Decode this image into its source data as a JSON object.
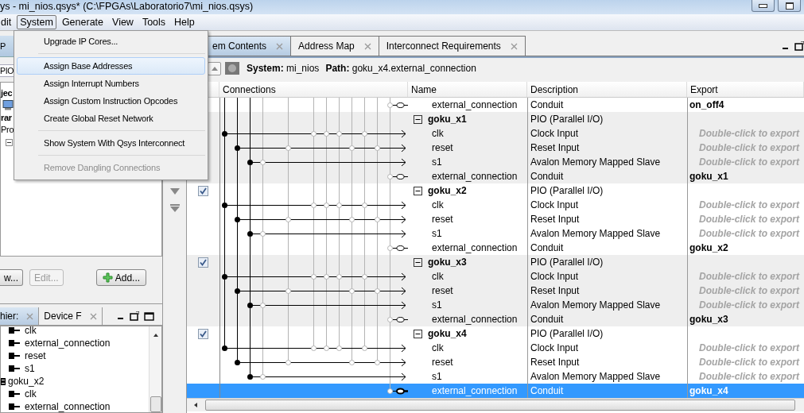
{
  "window": {
    "title": "ys - mi_nios.qsys* (C:\\FPGAs\\Laboratorio7\\mi_nios.qsys)"
  },
  "menu_bar": [
    {
      "label": "dit",
      "selected": false
    },
    {
      "label": "System",
      "selected": true
    },
    {
      "label": "Generate",
      "selected": false
    },
    {
      "label": "View",
      "selected": false
    },
    {
      "label": "Tools",
      "selected": false
    },
    {
      "label": "Help",
      "selected": false
    }
  ],
  "system_menu": [
    {
      "kind": "item",
      "label": "Upgrade IP Cores...",
      "selected": false,
      "disabled": false
    },
    {
      "kind": "separator"
    },
    {
      "kind": "item",
      "label": "Assign Base Addresses",
      "selected": true,
      "disabled": false
    },
    {
      "kind": "item",
      "label": "Assign Interrupt Numbers",
      "selected": false,
      "disabled": false
    },
    {
      "kind": "item",
      "label": "Assign Custom Instruction Opcodes",
      "selected": false,
      "disabled": false
    },
    {
      "kind": "item",
      "label": "Create Global Reset Network",
      "selected": false,
      "disabled": false
    },
    {
      "kind": "separator"
    },
    {
      "kind": "item",
      "label": "Show System With Qsys Interconnect",
      "selected": false,
      "disabled": false
    },
    {
      "kind": "separator"
    },
    {
      "kind": "item",
      "label": "Remove Dangling Connections",
      "selected": false,
      "disabled": true
    }
  ],
  "ip_catalog": {
    "tab": "P",
    "search_value": "PIO",
    "tree": [
      {
        "label": "jec",
        "kind": "project"
      },
      {
        "label": "rar",
        "kind": "library"
      },
      {
        "label": "Pro",
        "kind": "category",
        "expanded": true
      }
    ],
    "buttons": [
      {
        "label": "w...",
        "kind": "plain",
        "disabled": false
      },
      {
        "label": "Edit...",
        "kind": "plain",
        "disabled": true
      },
      {
        "label": "Add...",
        "kind": "add",
        "disabled": false
      }
    ]
  },
  "hierarchy_panel": {
    "tabs": [
      {
        "label": "hier:",
        "selected": true
      },
      {
        "label": "Device F",
        "selected": false
      }
    ],
    "tree": [
      {
        "label": "clk",
        "kind": "port"
      },
      {
        "label": "external_connection",
        "kind": "port"
      },
      {
        "label": "reset",
        "kind": "port"
      },
      {
        "label": "s1",
        "kind": "port"
      },
      {
        "label": "goku_x2",
        "kind": "module",
        "children": [
          {
            "label": "clk",
            "kind": "port"
          },
          {
            "label": "external_connection",
            "kind": "port"
          }
        ]
      }
    ]
  },
  "editor_tabs": [
    {
      "label": "em Contents",
      "selected": true
    },
    {
      "label": "Address Map",
      "selected": false
    },
    {
      "label": "Interconnect Requirements",
      "selected": false
    }
  ],
  "toolbar": {
    "system_label": "System:",
    "system": "mi_nios",
    "path_label": "Path:",
    "path": "goku_x4.external_connection"
  },
  "table": {
    "columns": [
      "Connections",
      "Name",
      "Description",
      "Export"
    ],
    "rows": [
      {
        "kind": "conduit",
        "name": "external_connection",
        "description": "Conduit",
        "export": "on_off4",
        "exported": true,
        "selected": false
      },
      {
        "kind": "module",
        "name": "goku_x1",
        "description": "PIO (Parallel I/O)",
        "expanded": true,
        "selected": false
      },
      {
        "kind": "clock",
        "name": "clk",
        "description": "Clock Input",
        "export": "Double-click to export",
        "exported": false,
        "selected": false
      },
      {
        "kind": "reset",
        "name": "reset",
        "description": "Reset Input",
        "export": "Double-click to export",
        "exported": false,
        "selected": false
      },
      {
        "kind": "slave",
        "name": "s1",
        "description": "Avalon Memory Mapped Slave",
        "export": "Double-click to export",
        "exported": false,
        "selected": false
      },
      {
        "kind": "conduit",
        "name": "external_connection",
        "description": "Conduit",
        "export": "goku_x1",
        "exported": true,
        "selected": false
      },
      {
        "kind": "module",
        "name": "goku_x2",
        "description": "PIO (Parallel I/O)",
        "expanded": true,
        "enabled": true,
        "selected": false
      },
      {
        "kind": "clock",
        "name": "clk",
        "description": "Clock Input",
        "export": "Double-click to export",
        "exported": false,
        "selected": false
      },
      {
        "kind": "reset",
        "name": "reset",
        "description": "Reset Input",
        "export": "Double-click to export",
        "exported": false,
        "selected": false
      },
      {
        "kind": "slave",
        "name": "s1",
        "description": "Avalon Memory Mapped Slave",
        "export": "Double-click to export",
        "exported": false,
        "selected": false
      },
      {
        "kind": "conduit",
        "name": "external_connection",
        "description": "Conduit",
        "export": "goku_x2",
        "exported": true,
        "selected": false
      },
      {
        "kind": "module",
        "name": "goku_x3",
        "description": "PIO (Parallel I/O)",
        "expanded": true,
        "enabled": true,
        "selected": false
      },
      {
        "kind": "clock",
        "name": "clk",
        "description": "Clock Input",
        "export": "Double-click to export",
        "exported": false,
        "selected": false
      },
      {
        "kind": "reset",
        "name": "reset",
        "description": "Reset Input",
        "export": "Double-click to export",
        "exported": false,
        "selected": false
      },
      {
        "kind": "slave",
        "name": "s1",
        "description": "Avalon Memory Mapped Slave",
        "export": "Double-click to export",
        "exported": false,
        "selected": false
      },
      {
        "kind": "conduit",
        "name": "external_connection",
        "description": "Conduit",
        "export": "goku_x3",
        "exported": true,
        "selected": false
      },
      {
        "kind": "module",
        "name": "goku_x4",
        "description": "PIO (Parallel I/O)",
        "expanded": true,
        "enabled": true,
        "selected": false
      },
      {
        "kind": "clock",
        "name": "clk",
        "description": "Clock Input",
        "export": "Double-click to export",
        "exported": false,
        "selected": false
      },
      {
        "kind": "reset",
        "name": "reset",
        "description": "Reset Input",
        "export": "Double-click to export",
        "exported": false,
        "selected": false
      },
      {
        "kind": "slave",
        "name": "s1",
        "description": "Avalon Memory Mapped Slave",
        "export": "Double-click to export",
        "exported": false,
        "selected": false
      },
      {
        "kind": "conduit",
        "name": "external_connection",
        "description": "Conduit",
        "export": "goku_x4",
        "exported": true,
        "selected": true
      }
    ]
  }
}
